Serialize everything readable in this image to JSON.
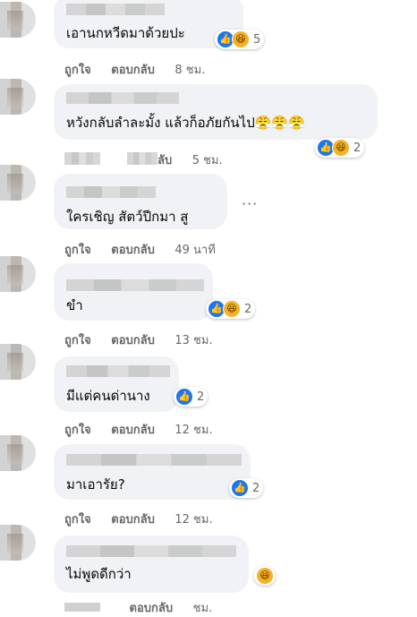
{
  "comments": [
    {
      "text": "เอานกหวีดมาด้วยปะ",
      "reaction_count": "5",
      "actions": {
        "like": "ถูกใจ",
        "reply": "ตอบกลับ",
        "time": "8 ชม."
      }
    },
    {
      "text": "หวังกลับลำละมั้ง แล้วก็อภัยกันไป😤😤😤",
      "reaction_count": "2",
      "actions": {
        "like": "",
        "reply": "ลับ",
        "time": "5 ชม."
      }
    },
    {
      "text": "ใครเชิญ สัตว์ปีกมา สู",
      "reaction_count": "",
      "actions": {
        "like": "ถูกใจ",
        "reply": "ตอบกลับ",
        "time": "49 นาที"
      },
      "more": "···"
    },
    {
      "text": "ขำ",
      "reaction_count": "2",
      "actions": {
        "like": "ถูกใจ",
        "reply": "ตอบกลับ",
        "time": "13 ชม."
      }
    },
    {
      "text": "มีแต่คนด่านาง",
      "reaction_count": "2",
      "actions": {
        "like": "ถูกใจ",
        "reply": "ตอบกลับ",
        "time": "12 ชม."
      }
    },
    {
      "text": "มาเอารัย?",
      "reaction_count": "2",
      "actions": {
        "like": "ถูกใจ",
        "reply": "ตอบกลับ",
        "time": "12 ชม."
      }
    },
    {
      "text": "ไม่พูดดีกว่า",
      "reaction_count": "",
      "actions": {
        "like": "",
        "reply": "ตอบกลับ",
        "time": "ชม."
      }
    }
  ],
  "icons": {
    "like": "like-icon",
    "haha": "haha-icon",
    "more": "more-options-icon"
  },
  "colors": {
    "bubble": "#f0f2f5",
    "meta_text": "#65676b",
    "like_blue": "#1877f2",
    "haha_yellow": "#f7b125"
  }
}
